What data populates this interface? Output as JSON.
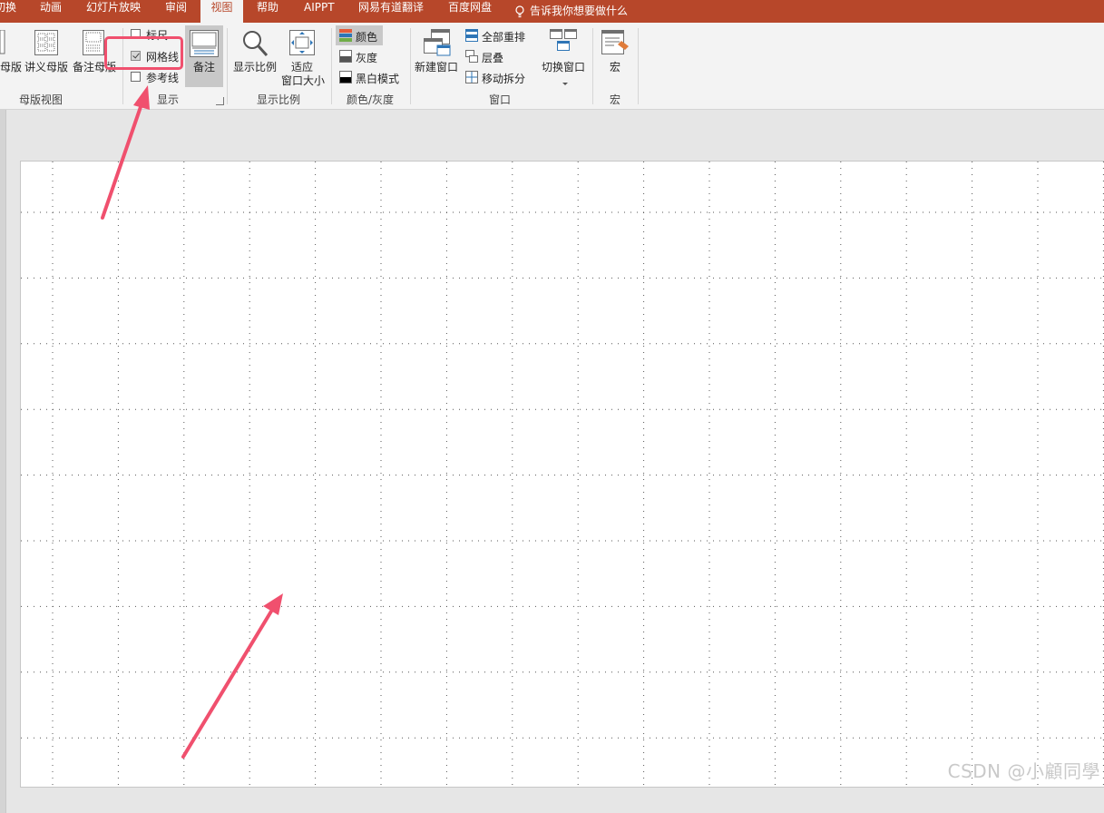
{
  "tabs": [
    {
      "label": "切换"
    },
    {
      "label": "动画"
    },
    {
      "label": "幻灯片放映"
    },
    {
      "label": "审阅"
    },
    {
      "label": "视图"
    },
    {
      "label": "帮助"
    },
    {
      "label": "AIPPT"
    },
    {
      "label": "网易有道翻译"
    },
    {
      "label": "百度网盘"
    }
  ],
  "tell_me": "告诉我你想要做什么",
  "groups": {
    "master_views": {
      "label": "母版视图",
      "buttons": [
        {
          "label": "母版"
        },
        {
          "label": "讲义母版"
        },
        {
          "label": "备注母版"
        }
      ]
    },
    "show": {
      "label": "显示",
      "ruler": "标尺",
      "gridlines": "网格线",
      "guides": "参考线",
      "notes": "备注",
      "gridlines_checked": true,
      "ruler_checked": false,
      "guides_checked": false
    },
    "zoom": {
      "label": "显示比例",
      "zoom_btn": "显示比例",
      "fit_line1": "适应",
      "fit_line2": "窗口大小"
    },
    "color": {
      "label": "颜色/灰度",
      "items": [
        {
          "label": "颜色"
        },
        {
          "label": "灰度"
        },
        {
          "label": "黑白模式"
        }
      ]
    },
    "window": {
      "label": "窗口",
      "new_window": "新建窗口",
      "items": [
        {
          "label": "全部重排"
        },
        {
          "label": "层叠"
        },
        {
          "label": "移动拆分"
        }
      ],
      "switch": "切换窗口"
    },
    "macros": {
      "label": "宏",
      "macros_btn": "宏"
    }
  },
  "watermark": "CSDN @小顧同學",
  "colors": {
    "tabbar": "#b7472a",
    "highlight": "#f0506e",
    "ribbon": "#f3f3f3"
  }
}
